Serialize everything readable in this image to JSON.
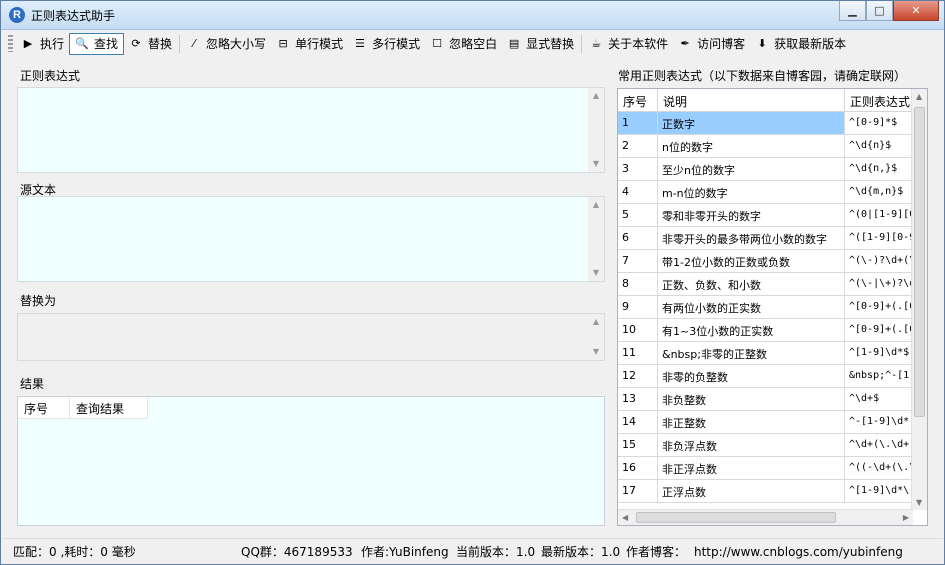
{
  "window": {
    "title": "正则表达式助手",
    "app_icon": "R"
  },
  "toolbar": {
    "execute": "执行",
    "find": "查找",
    "replace": "替换",
    "ignore_case": "忽略大小写",
    "single_line": "单行模式",
    "multi_line": "多行模式",
    "ignore_whitespace": "忽略空白",
    "explicit_replace": "显式替换",
    "about": "关于本软件",
    "visit_blog": "访问博客",
    "get_latest": "获取最新版本"
  },
  "panels": {
    "regex_label": "正则表达式",
    "source_label": "源文本",
    "replace_label": "替换为",
    "result_label": "结果"
  },
  "result_table": {
    "columns": [
      "序号",
      "查询结果"
    ]
  },
  "common_regex": {
    "title": "常用正则表达式（以下数据来自博客园，请确定联网）",
    "columns": [
      "序号",
      "说明",
      "正则表达式"
    ],
    "selected_index": 0,
    "rows": [
      {
        "no": "1",
        "desc": "正数字",
        "regex": "^[0-9]*$"
      },
      {
        "no": "2",
        "desc": "n位的数字",
        "regex": "^\\d{n}$"
      },
      {
        "no": "3",
        "desc": "至少n位的数字",
        "regex": "^\\d{n,}$"
      },
      {
        "no": "4",
        "desc": "m-n位的数字",
        "regex": "^\\d{m,n}$"
      },
      {
        "no": "5",
        "desc": "零和非零开头的数字",
        "regex": "^(0|[1-9][0"
      },
      {
        "no": "6",
        "desc": "非零开头的最多带两位小数的数字",
        "regex": "^([1-9][0-9"
      },
      {
        "no": "7",
        "desc": "带1-2位小数的正数或负数",
        "regex": "^(\\-)?\\d+(\\"
      },
      {
        "no": "8",
        "desc": "正数、负数、和小数",
        "regex": "^(\\-|\\+)?\\d"
      },
      {
        "no": "9",
        "desc": "有两位小数的正实数",
        "regex": "^[0-9]+(.[0"
      },
      {
        "no": "10",
        "desc": "有1~3位小数的正实数",
        "regex": "^[0-9]+(.[0"
      },
      {
        "no": "11",
        "desc": "&nbsp;非零的正整数",
        "regex": "^[1-9]\\d*$"
      },
      {
        "no": "12",
        "desc": "非零的负整数",
        "regex": "&nbsp;^-[1-"
      },
      {
        "no": "13",
        "desc": "非负整数",
        "regex": "^\\d+$"
      },
      {
        "no": "14",
        "desc": "非正整数",
        "regex": "^-[1-9]\\d*"
      },
      {
        "no": "15",
        "desc": "非负浮点数",
        "regex": "^\\d+(\\.\\d+)"
      },
      {
        "no": "16",
        "desc": "非正浮点数",
        "regex": "^((-\\d+(\\.\\"
      },
      {
        "no": "17",
        "desc": "正浮点数",
        "regex": "^[1-9]\\d*\\."
      }
    ]
  },
  "status": {
    "match": "匹配：0 ,耗时：0 毫秒",
    "qq": "QQ群：467189533",
    "author": "作者:YuBinfeng",
    "current_version": "当前版本：1.0",
    "latest_version": "最新版本：1.0",
    "blog_label": "作者博客：",
    "blog_url": "http://www.cnblogs.com/yubinfeng"
  }
}
